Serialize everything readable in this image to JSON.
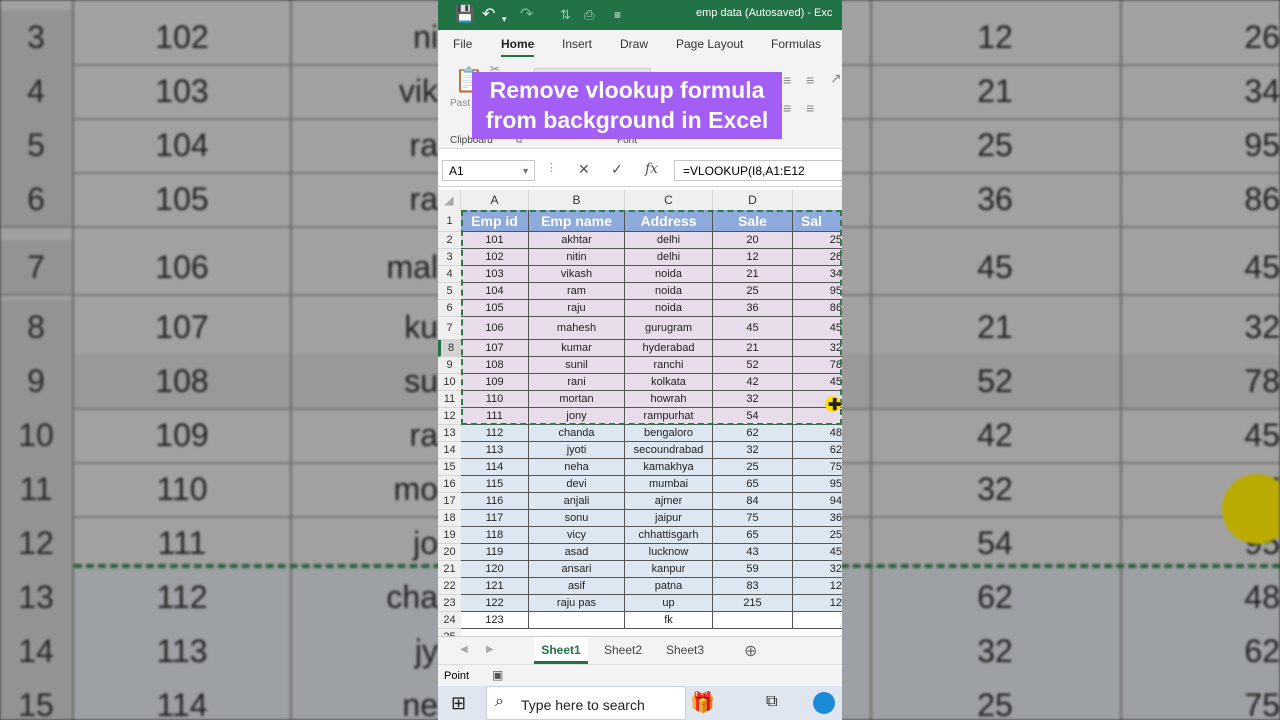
{
  "bg": {
    "rows": [
      {
        "num": "3",
        "id": "102",
        "name": "ni",
        "sale": "12",
        "sale2": "26"
      },
      {
        "num": "4",
        "id": "103",
        "name": "vik",
        "sale": "21",
        "sale2": "34"
      },
      {
        "num": "5",
        "id": "104",
        "name": "ra",
        "sale": "25",
        "sale2": "95"
      },
      {
        "num": "6",
        "id": "105",
        "name": "ra",
        "sale": "36",
        "sale2": "86"
      },
      {
        "num": "7",
        "id": "106",
        "name": "mal",
        "sale": "45",
        "sale2": "45"
      },
      {
        "num": "8",
        "id": "107",
        "name": "ku",
        "sale": "21",
        "sale2": "32"
      },
      {
        "num": "9",
        "id": "108",
        "name": "su",
        "sale": "52",
        "sale2": "78"
      },
      {
        "num": "10",
        "id": "109",
        "name": "ra",
        "sale": "42",
        "sale2": "45"
      },
      {
        "num": "11",
        "id": "110",
        "name": "mo",
        "sale": "32",
        "sale2": "7"
      },
      {
        "num": "12",
        "id": "111",
        "name": "jo",
        "sale": "54",
        "sale2": "95"
      },
      {
        "num": "13",
        "id": "112",
        "name": "cha",
        "sale": "62",
        "sale2": "48"
      },
      {
        "num": "14",
        "id": "113",
        "name": "jy",
        "sale": "32",
        "sale2": "62"
      },
      {
        "num": "15",
        "id": "114",
        "name": "ne",
        "sale": "25",
        "sale2": "75"
      }
    ]
  },
  "titlebar": {
    "document_title": "emp data (Autosaved)  -  Exc",
    "save_icon": "save-icon",
    "undo_icon": "undo-icon",
    "redo_icon": "redo-icon"
  },
  "menu": {
    "items": [
      "File",
      "Home",
      "Insert",
      "Draw",
      "Page Layout",
      "Formulas"
    ],
    "active": "Home"
  },
  "ribbon": {
    "clipboard_label": "Clipboard",
    "font_label": "Font",
    "paste_label": "Past"
  },
  "overlay": {
    "line1": "Remove vlookup formula",
    "line2": "from background in Excel"
  },
  "formula_bar": {
    "name_box": "A1",
    "formula": "=VLOOKUP(I8,A1:E12"
  },
  "grid": {
    "columns": [
      "A",
      "B",
      "C",
      "D"
    ],
    "header": [
      "Emp id",
      "Emp name",
      "Address",
      "Sale",
      "Sal"
    ],
    "rows": [
      {
        "id": "101",
        "name": "akhtar",
        "address": "delhi",
        "sale": "20",
        "e": "25"
      },
      {
        "id": "102",
        "name": "nitin",
        "address": "delhi",
        "sale": "12",
        "e": "26"
      },
      {
        "id": "103",
        "name": "vikash",
        "address": "noida",
        "sale": "21",
        "e": "34"
      },
      {
        "id": "104",
        "name": "ram",
        "address": "noida",
        "sale": "25",
        "e": "95"
      },
      {
        "id": "105",
        "name": "raju",
        "address": "noida",
        "sale": "36",
        "e": "86"
      },
      {
        "id": "106",
        "name": "mahesh",
        "address": "gurugram",
        "sale": "45",
        "e": "45"
      },
      {
        "id": "107",
        "name": "kumar",
        "address": "hyderabad",
        "sale": "21",
        "e": "32"
      },
      {
        "id": "108",
        "name": "sunil",
        "address": "ranchi",
        "sale": "52",
        "e": "78"
      },
      {
        "id": "109",
        "name": "rani",
        "address": "kolkata",
        "sale": "42",
        "e": "45"
      },
      {
        "id": "110",
        "name": "mortan",
        "address": "howrah",
        "sale": "32",
        "e": ""
      },
      {
        "id": "111",
        "name": "jony",
        "address": "rampurhat",
        "sale": "54",
        "e": ""
      },
      {
        "id": "112",
        "name": "chanda",
        "address": "bengaloro",
        "sale": "62",
        "e": "48"
      },
      {
        "id": "113",
        "name": "jyoti",
        "address": "secoundrabad",
        "sale": "32",
        "e": "62"
      },
      {
        "id": "114",
        "name": "neha",
        "address": "kamakhya",
        "sale": "25",
        "e": "75"
      },
      {
        "id": "115",
        "name": "devi",
        "address": "mumbai",
        "sale": "65",
        "e": "95"
      },
      {
        "id": "116",
        "name": "anjali",
        "address": "ajmer",
        "sale": "84",
        "e": "94"
      },
      {
        "id": "117",
        "name": "sonu",
        "address": "jaipur",
        "sale": "75",
        "e": "36"
      },
      {
        "id": "118",
        "name": "vicy",
        "address": "chhattisgarh",
        "sale": "65",
        "e": "25"
      },
      {
        "id": "119",
        "name": "asad",
        "address": "lucknow",
        "sale": "43",
        "e": "45"
      },
      {
        "id": "120",
        "name": "ansari",
        "address": "kanpur",
        "sale": "59",
        "e": "32"
      },
      {
        "id": "121",
        "name": "asif",
        "address": "patna",
        "sale": "83",
        "e": "12"
      },
      {
        "id": "122",
        "name": "raju pas",
        "address": "up",
        "sale": "215",
        "e": "12"
      },
      {
        "id": "123",
        "name": "",
        "address": "fk",
        "sale": "",
        "e": ""
      }
    ],
    "row_numbers": [
      "1",
      "2",
      "3",
      "4",
      "5",
      "6",
      "7",
      "8",
      "9",
      "10",
      "11",
      "12",
      "13",
      "14",
      "15",
      "16",
      "17",
      "18",
      "19",
      "20",
      "21",
      "22",
      "23",
      "24",
      "25"
    ]
  },
  "sheets": {
    "tabs": [
      "Sheet1",
      "Sheet2",
      "Sheet3"
    ],
    "active": "Sheet1",
    "add_icon": "add-sheet-icon"
  },
  "status": {
    "mode": "Point"
  },
  "taskbar": {
    "search_placeholder": "Type here to search"
  },
  "colors": {
    "excel_green": "#217346",
    "header_blue": "#8ea9db",
    "overlay_purple": "#a35ef5"
  }
}
